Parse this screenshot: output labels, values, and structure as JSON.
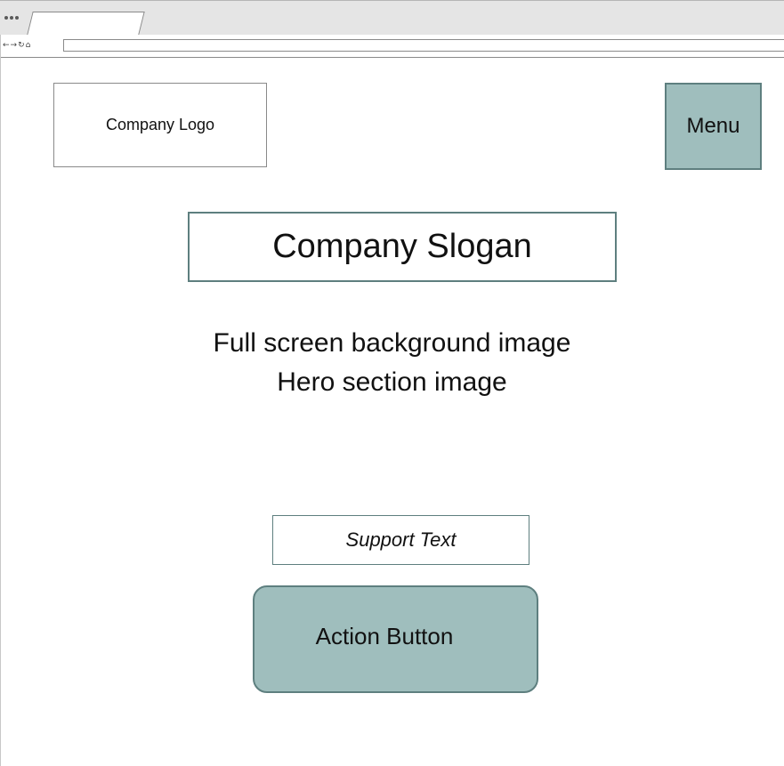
{
  "browser": {
    "nav_icons": [
      "←",
      "→",
      "↻",
      "⌂"
    ]
  },
  "header": {
    "logo_text": "Company Logo",
    "menu_label": "Menu"
  },
  "hero": {
    "slogan": "Company Slogan",
    "background_line1": "Full screen background image",
    "background_line2": "Hero section image",
    "support_text": "Support Text",
    "action_label": "Action Button"
  },
  "colors": {
    "accent_fill": "#9fbebd",
    "accent_border": "#5e7f7f"
  }
}
